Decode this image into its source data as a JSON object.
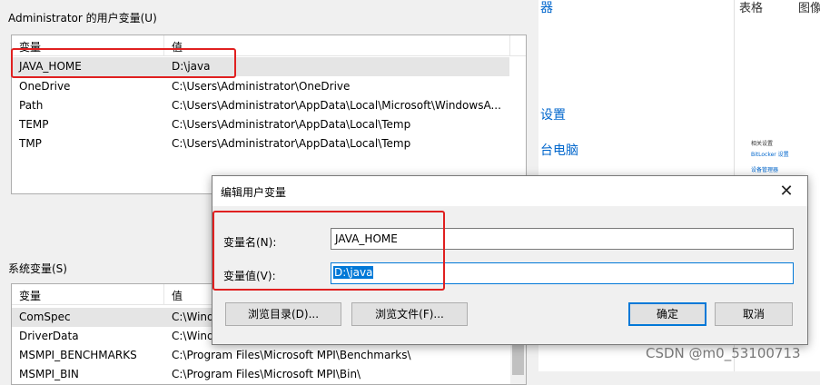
{
  "user_vars": {
    "group_label": "Administrator 的用户变量(U)",
    "columns": [
      "变量",
      "值"
    ],
    "rows": [
      {
        "name": "JAVA_HOME",
        "value": "D:\\java"
      },
      {
        "name": "OneDrive",
        "value": "C:\\Users\\Administrator\\OneDrive"
      },
      {
        "name": "Path",
        "value": "C:\\Users\\Administrator\\AppData\\Local\\Microsoft\\WindowsA..."
      },
      {
        "name": "TEMP",
        "value": "C:\\Users\\Administrator\\AppData\\Local\\Temp"
      },
      {
        "name": "TMP",
        "value": "C:\\Users\\Administrator\\AppData\\Local\\Temp"
      }
    ]
  },
  "system_vars": {
    "group_label": "系统变量(S)",
    "columns": [
      "变量",
      "值"
    ],
    "rows": [
      {
        "name": "ComSpec",
        "value": "C:\\Wind"
      },
      {
        "name": "DriverData",
        "value": "C:\\Wind"
      },
      {
        "name": "MSMPI_BENCHMARKS",
        "value": "C:\\Program Files\\Microsoft MPI\\Benchmarks\\"
      },
      {
        "name": "MSMPI_BIN",
        "value": "C:\\Program Files\\Microsoft MPI\\Bin\\"
      }
    ]
  },
  "settings_panel": {
    "links": [
      "器",
      "设置",
      "台电脑"
    ]
  },
  "mini_panel": {
    "tab1": "表格",
    "tab2": "图像",
    "heading": "相关设置",
    "link1": "BitLocker 设置",
    "link2": "设备管理器"
  },
  "dialog": {
    "title": "编辑用户变量",
    "close_glyph": "✕",
    "name_label": "变量名(N):",
    "name_value": "JAVA_HOME",
    "value_label": "变量值(V):",
    "value_value": "D:\\java",
    "browse_dir": "浏览目录(D)...",
    "browse_file": "浏览文件(F)...",
    "ok": "确定",
    "cancel": "取消"
  },
  "watermark": "CSDN @m0_53100713",
  "colors": {
    "highlight": "#e02020",
    "accent": "#0078d7",
    "link": "#0066cc"
  }
}
